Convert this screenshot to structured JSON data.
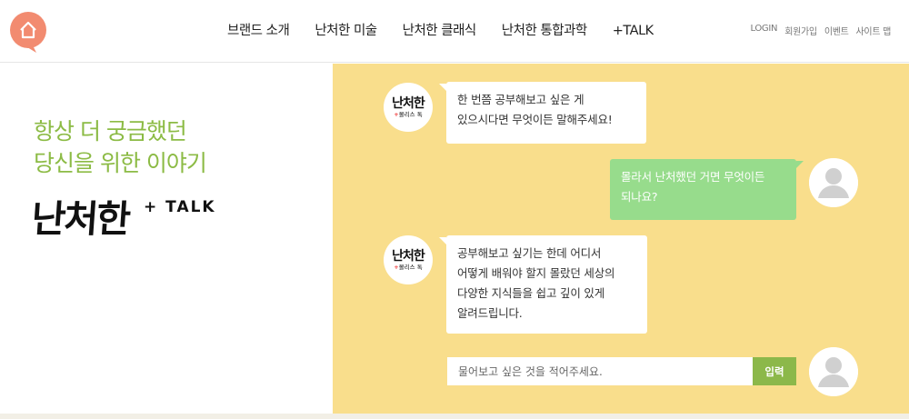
{
  "header": {
    "logo_icon": "home-speech-bubble-icon",
    "logo_color": "#f28b70",
    "nav": [
      {
        "label": "브랜드 소개"
      },
      {
        "label": "난처한 미술"
      },
      {
        "label": "난처한 클래식"
      },
      {
        "label": "난처한 통합과학"
      },
      {
        "label": "+TALK"
      }
    ],
    "util": [
      {
        "label": "LOGIN"
      },
      {
        "label": "회원가입"
      },
      {
        "label": "이벤트"
      },
      {
        "label": "사이트 맵"
      }
    ]
  },
  "hero": {
    "headline_line1": "항상 더 궁금했던",
    "headline_line2": "당신을 위한 이야기",
    "brand_word": "난처한",
    "brand_talk": "+ TALK",
    "accent_color": "#8cbb45"
  },
  "chat": {
    "background": "#f9de8c",
    "brand_avatar": {
      "main": "난처한",
      "plus": "+",
      "sub": "몰리스 톡"
    },
    "user_avatar_icon": "user-silhouette-icon",
    "messages": [
      {
        "from": "brand",
        "line1": "한 번쯤 공부해보고 싶은 게",
        "line2": "있으시다면 무엇이든 말해주세요!"
      },
      {
        "from": "user",
        "line1": "몰라서 난처했던 거면 무엇이든",
        "line2": "되나요?"
      },
      {
        "from": "brand",
        "line1": "공부해보고 싶기는 한데 어디서",
        "line2": "어떻게 배워야 할지 몰랐던 세상의",
        "line3": "다양한 지식들을 쉽고 깊이 있게",
        "line4": "알려드립니다."
      }
    ],
    "input": {
      "placeholder": "물어보고 싶은 것을 적어주세요.",
      "value": ""
    },
    "submit_label": "입력"
  }
}
